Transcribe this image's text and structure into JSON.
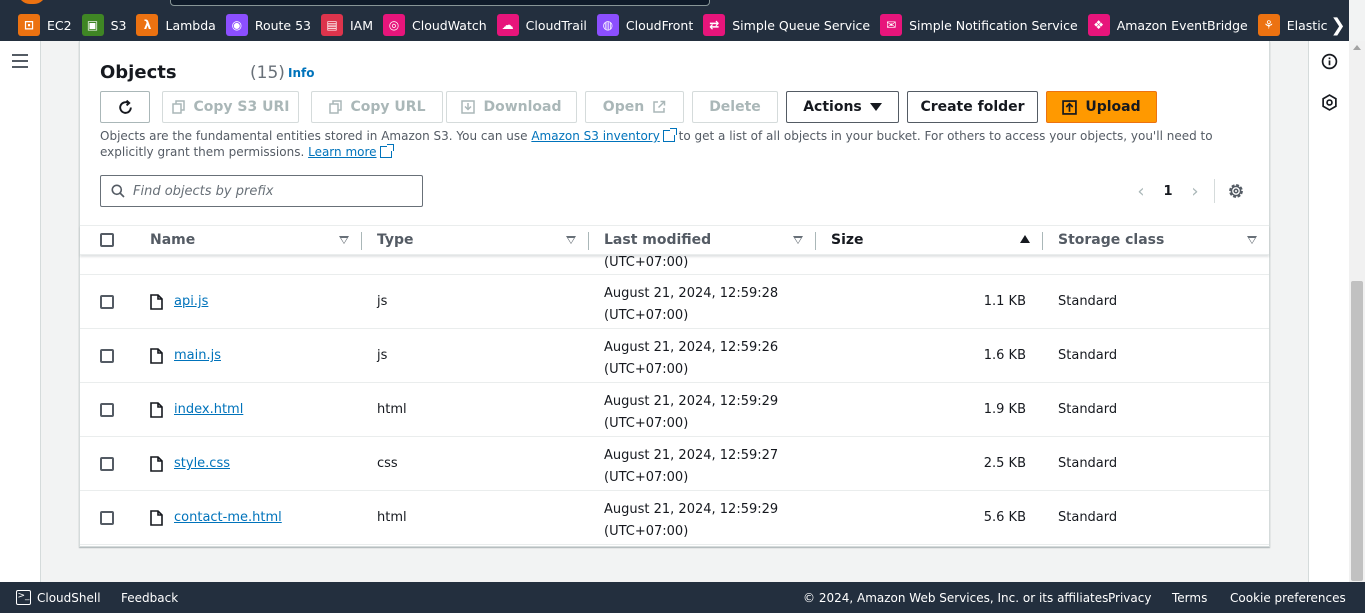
{
  "services": [
    {
      "label": "EC2",
      "color": "#ec7211",
      "icon": "ec2-icon"
    },
    {
      "label": "S3",
      "color": "#3f8624",
      "icon": "s3-icon"
    },
    {
      "label": "Lambda",
      "color": "#ec7211",
      "icon": "lambda-icon"
    },
    {
      "label": "Route 53",
      "color": "#8c4fff",
      "icon": "route53-icon"
    },
    {
      "label": "IAM",
      "color": "#dd344c",
      "icon": "iam-icon"
    },
    {
      "label": "CloudWatch",
      "color": "#e7157b",
      "icon": "cloudwatch-icon"
    },
    {
      "label": "CloudTrail",
      "color": "#e7157b",
      "icon": "cloudtrail-icon"
    },
    {
      "label": "CloudFront",
      "color": "#8c4fff",
      "icon": "cloudfront-icon"
    },
    {
      "label": "Simple Queue Service",
      "color": "#e7157b",
      "icon": "sqs-icon"
    },
    {
      "label": "Simple Notification Service",
      "color": "#e7157b",
      "icon": "sns-icon"
    },
    {
      "label": "Amazon EventBridge",
      "color": "#e7157b",
      "icon": "eventbridge-icon"
    },
    {
      "label": "Elastic Beanstalk",
      "color": "#ec7211",
      "icon": "beanstalk-icon"
    }
  ],
  "objects": {
    "title": "Objects",
    "count": "(15)",
    "info": "Info",
    "buttons": {
      "copy_s3_uri": "Copy S3 URI",
      "copy_url": "Copy URL",
      "download": "Download",
      "open": "Open",
      "delete": "Delete",
      "actions": "Actions",
      "create_folder": "Create folder",
      "upload": "Upload"
    },
    "description": {
      "part1": "Objects are the fundamental entities stored in Amazon S3. You can use ",
      "link1": "Amazon S3 inventory",
      "part2": " to get a list of all objects in your bucket. For others to access your objects, you'll need to explicitly grant them permissions. ",
      "link2": "Learn more"
    },
    "search_placeholder": "Find objects by prefix",
    "page": "1",
    "columns": {
      "name": "Name",
      "type": "Type",
      "last_modified": "Last modified",
      "size": "Size",
      "storage_class": "Storage class"
    },
    "partial_row": {
      "date_tail": "(UTC+07:00)"
    },
    "rows": [
      {
        "name": "api.js",
        "type": "js",
        "date1": "August 21, 2024, 12:59:28",
        "date2": "(UTC+07:00)",
        "size": "1.1 KB",
        "class": "Standard"
      },
      {
        "name": "main.js",
        "type": "js",
        "date1": "August 21, 2024, 12:59:26",
        "date2": "(UTC+07:00)",
        "size": "1.6 KB",
        "class": "Standard"
      },
      {
        "name": "index.html",
        "type": "html",
        "date1": "August 21, 2024, 12:59:29",
        "date2": "(UTC+07:00)",
        "size": "1.9 KB",
        "class": "Standard"
      },
      {
        "name": "style.css",
        "type": "css",
        "date1": "August 21, 2024, 12:59:27",
        "date2": "(UTC+07:00)",
        "size": "2.5 KB",
        "class": "Standard"
      },
      {
        "name": "contact-me.html",
        "type": "html",
        "date1": "August 21, 2024, 12:59:29",
        "date2": "(UTC+07:00)",
        "size": "5.6 KB",
        "class": "Standard"
      }
    ]
  },
  "footer": {
    "cloudshell": "CloudShell",
    "feedback": "Feedback",
    "copyright": "© 2024, Amazon Web Services, Inc. or its affiliates.",
    "privacy": "Privacy",
    "terms": "Terms",
    "cookies": "Cookie preferences"
  }
}
